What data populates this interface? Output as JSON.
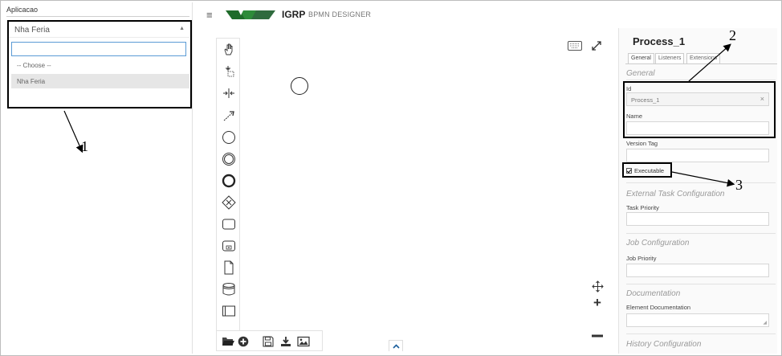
{
  "left_panel": {
    "label": "Aplicacao",
    "selected_value": "Nha Feria",
    "search_value": "",
    "options": [
      "-- Choose --",
      "Nha Feria"
    ]
  },
  "header": {
    "brand": "IGRP",
    "subtitle": "BPMN DESIGNER"
  },
  "canvas": {
    "palette_tools": [
      "hand-tool-icon",
      "lasso-tool-icon",
      "space-tool-icon",
      "connect-tool-icon",
      "start-event-icon",
      "intermediate-event-icon",
      "end-event-icon",
      "gateway-icon",
      "task-icon",
      "subprocess-icon",
      "data-object-icon",
      "data-store-icon",
      "pool-icon"
    ],
    "bottom_tools": [
      "open-folder-icon",
      "new-diagram-icon",
      "save-icon",
      "download-icon",
      "image-icon"
    ]
  },
  "properties": {
    "title": "Process_1",
    "tabs": [
      "General",
      "Listeners",
      "Extensions"
    ],
    "active_tab": "General",
    "general_heading": "General",
    "id_label": "Id",
    "id_value": "Process_1",
    "name_label": "Name",
    "name_value": "",
    "version_tag_label": "Version Tag",
    "version_tag_value": "",
    "executable_label": "Executable",
    "executable_checked": true,
    "external_task_heading": "External Task Configuration",
    "task_priority_label": "Task Priority",
    "job_config_heading": "Job Configuration",
    "job_priority_label": "Job Priority",
    "documentation_heading": "Documentation",
    "element_doc_label": "Element Documentation",
    "history_heading": "History Configuration"
  },
  "annotations": [
    "1",
    "2",
    "3"
  ],
  "colors": {
    "logo_green": "#2e8b3a",
    "logo_dark_green": "#1f6b2a",
    "focus_blue": "#5b9bd5",
    "annotation": "#000000"
  }
}
